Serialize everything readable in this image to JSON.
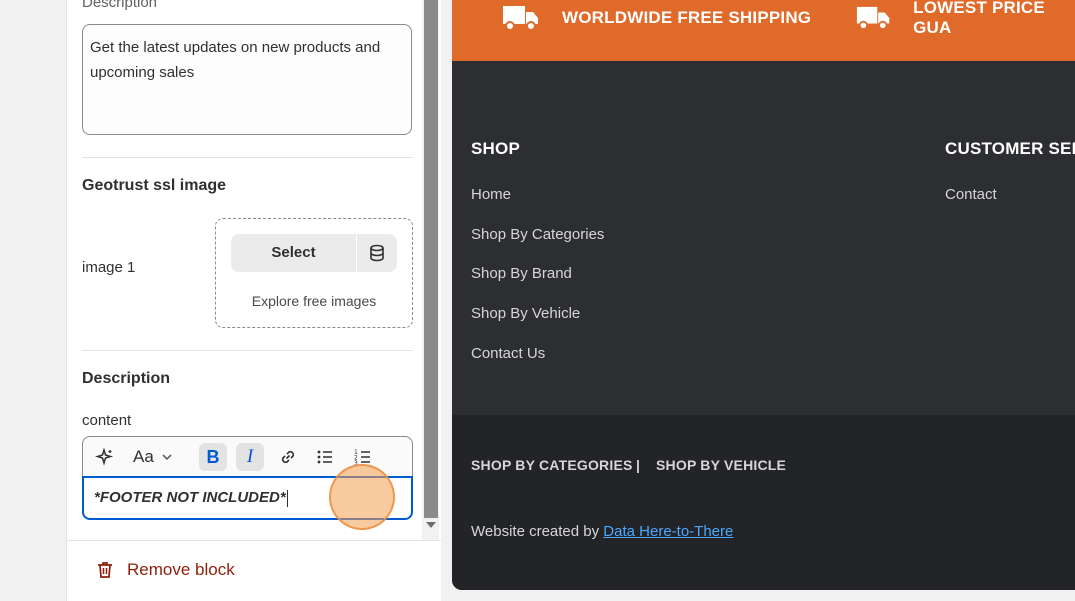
{
  "settings": {
    "top_label": "Description",
    "description_text": "Get the latest updates on new products and upcoming sales",
    "geotrust": {
      "title": "Geotrust ssl image",
      "image_label": "image 1",
      "select_label": "Select",
      "explore_label": "Explore free images"
    },
    "description2": {
      "title": "Description",
      "content_label": "content",
      "editor_value": "*FOOTER NOT INCLUDED*"
    },
    "remove_label": "Remove block"
  },
  "preview": {
    "banner": [
      {
        "text": "WORLDWIDE FREE SHIPPING",
        "icon": "truck-icon"
      },
      {
        "text": "LOWEST PRICE GUA",
        "icon": "truck-icon"
      }
    ],
    "shop": {
      "title": "SHOP",
      "links": [
        "Home",
        "Shop By Categories",
        "Shop By Brand",
        "Shop By Vehicle",
        "Contact Us"
      ]
    },
    "customer": {
      "title": "CUSTOMER SERV",
      "links": [
        "Contact"
      ]
    },
    "bottom_links": [
      "SHOP BY CATEGORIES",
      "|",
      "SHOP BY VEHICLE"
    ],
    "credit_prefix": "Website created by",
    "credit_link": "Data Here-to-There"
  },
  "colors": {
    "banner": "#e06a2a",
    "footer": "#2d2e31",
    "footer_bottom": "#232427",
    "link": "#4aa8ff",
    "focus": "#005bd3",
    "danger": "#8e1f0b"
  }
}
